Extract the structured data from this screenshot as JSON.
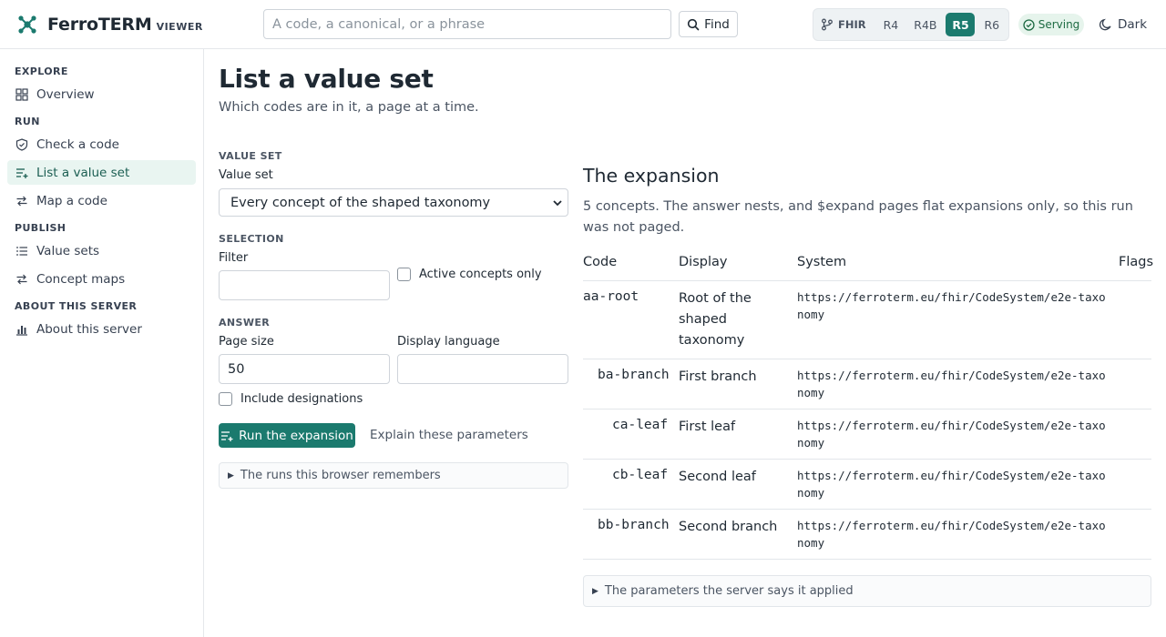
{
  "header": {
    "brand_name": "FerroTERM",
    "brand_sub": "VIEWER",
    "search_placeholder": "A code, a canonical, or a phrase",
    "find_label": "Find",
    "fhir_label": "FHIR",
    "versions": [
      "R4",
      "R4B",
      "R5",
      "R6"
    ],
    "active_version": "R5",
    "status": "Serving",
    "theme_label": "Dark",
    "accent_color": "#1b7a6e"
  },
  "sidebar": {
    "explore": "EXPLORE",
    "overview": "Overview",
    "run": "RUN",
    "check_code": "Check a code",
    "list_value_set": "List a value set",
    "map_code": "Map a code",
    "publish": "PUBLISH",
    "value_sets": "Value sets",
    "concept_maps": "Concept maps",
    "about_section": "ABOUT THIS SERVER",
    "about": "About this server"
  },
  "main": {
    "title": "List a value set",
    "subtitle": "Which codes are in it, a page at a time."
  },
  "form": {
    "value_set_section": "VALUE SET",
    "value_set_label": "Value set",
    "value_set_selected": "Every concept of the shaped taxonomy",
    "selection_section": "SELECTION",
    "filter_label": "Filter",
    "filter_value": "",
    "active_only_label": "Active concepts only",
    "answer_section": "ANSWER",
    "page_size_label": "Page size",
    "page_size_value": "50",
    "display_language_label": "Display language",
    "display_language_value": "",
    "include_designations_label": "Include designations",
    "run_label": "Run the expansion",
    "explain_label": "Explain these parameters",
    "history_label": "The runs this browser remembers"
  },
  "results": {
    "title": "The expansion",
    "summary": "5 concepts. The answer nests, and $expand pages flat expansions only, so this run was not paged.",
    "columns": {
      "code": "Code",
      "display": "Display",
      "system": "System",
      "flags": "Flags"
    },
    "rows": [
      {
        "code": "aa-root",
        "display": "Root of the shaped taxonomy",
        "system": "https://ferroterm.eu/fhir/CodeSystem/e2e-taxonomy"
      },
      {
        "code": "ba-branch",
        "display": "First branch",
        "system": "https://ferroterm.eu/fhir/CodeSystem/e2e-taxonomy"
      },
      {
        "code": "ca-leaf",
        "display": "First leaf",
        "system": "https://ferroterm.eu/fhir/CodeSystem/e2e-taxonomy"
      },
      {
        "code": "cb-leaf",
        "display": "Second leaf",
        "system": "https://ferroterm.eu/fhir/CodeSystem/e2e-taxonomy"
      },
      {
        "code": "bb-branch",
        "display": "Second branch",
        "system": "https://ferroterm.eu/fhir/CodeSystem/e2e-taxonomy"
      }
    ],
    "applied_params_label": "The parameters the server says it applied"
  }
}
